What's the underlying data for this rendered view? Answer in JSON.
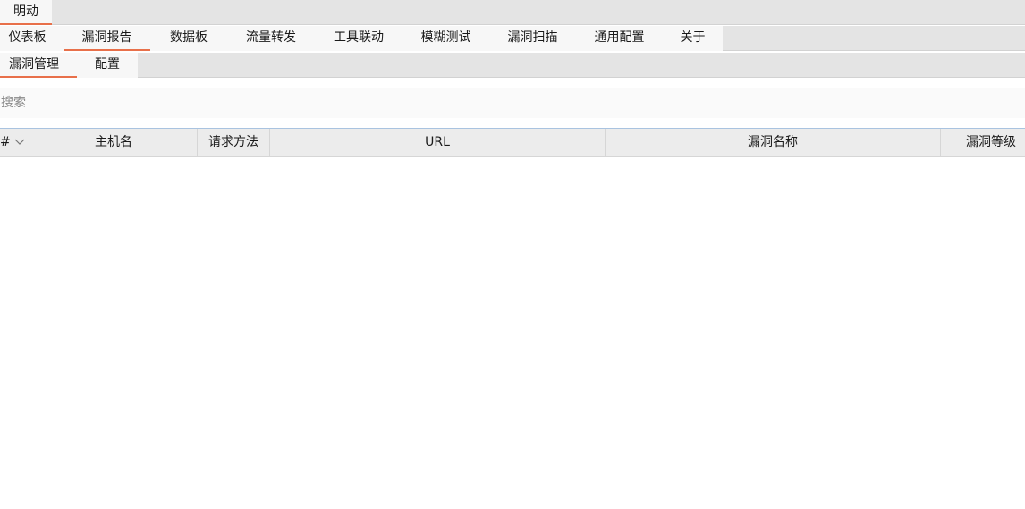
{
  "top_tabs": [
    {
      "label": "明动",
      "active": true
    }
  ],
  "main_tabs": [
    {
      "label": "仪表板",
      "active": false
    },
    {
      "label": "漏洞报告",
      "active": true
    },
    {
      "label": "数据板",
      "active": false
    },
    {
      "label": "流量转发",
      "active": false
    },
    {
      "label": "工具联动",
      "active": false
    },
    {
      "label": "模糊测试",
      "active": false
    },
    {
      "label": "漏洞扫描",
      "active": false
    },
    {
      "label": "通用配置",
      "active": false
    },
    {
      "label": "关于",
      "active": false
    }
  ],
  "sub_tabs": [
    {
      "label": "漏洞管理",
      "active": true
    },
    {
      "label": "配置",
      "active": false
    }
  ],
  "search": {
    "placeholder": "搜索",
    "value": ""
  },
  "table": {
    "columns": [
      "#",
      "主机名",
      "请求方法",
      "URL",
      "漏洞名称",
      "漏洞等级"
    ],
    "sort_indicator": "chevron-down-icon",
    "rows": []
  },
  "colors": {
    "accent": "#e8704a",
    "tabbar_bg": "#e4e4e4",
    "header_bg": "#ececec"
  }
}
